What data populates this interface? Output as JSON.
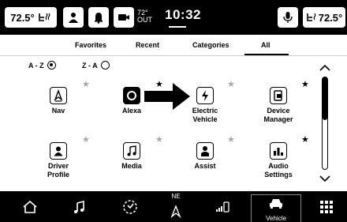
{
  "status_bar": {
    "left_temp": "72.5°",
    "outside_temp": "72°",
    "outside_label": "OUT",
    "clock": "10:32",
    "right_temp": "72.5°"
  },
  "tabs": [
    "Favorites",
    "Recent",
    "Categories",
    "All"
  ],
  "active_tab": "All",
  "sort": {
    "az_label": "A - Z",
    "za_label": "Z - A",
    "selected": "A - Z"
  },
  "apps": [
    {
      "label": "Nav",
      "icon": "nav-icon",
      "favorite": false
    },
    {
      "label": "Alexa",
      "icon": "alexa-icon",
      "favorite": true
    },
    {
      "label": "Electric Vehicle",
      "line1": "Electric",
      "line2": "Vehicle",
      "icon": "electric-vehicle-icon",
      "favorite": false
    },
    {
      "label": "Device Manager",
      "line1": "Device",
      "line2": "Manager",
      "icon": "device-manager-icon",
      "favorite": true
    },
    {
      "label": "Driver Profile",
      "line1": "Driver",
      "line2": "Profile",
      "icon": "driver-profile-icon",
      "favorite": false
    },
    {
      "label": "Media",
      "icon": "media-icon",
      "favorite": false
    },
    {
      "label": "Assist",
      "icon": "assist-icon",
      "favorite": false
    },
    {
      "label": "Audio Settings",
      "line1": "Audio",
      "line2": "Settings",
      "icon": "audio-settings-icon",
      "favorite": true
    }
  ],
  "bottom_nav": {
    "compass": "NE",
    "vehicle_label": "Vehicle",
    "items": [
      "home-icon",
      "music-icon",
      "steering-assist-icon",
      "compass-icon",
      "phone-signal-icon",
      "vehicle-icon",
      "apps-grid-icon"
    ]
  },
  "colors": {
    "background": "#000000",
    "panel": "#ffffff",
    "star_empty": "#a8a8a8"
  }
}
